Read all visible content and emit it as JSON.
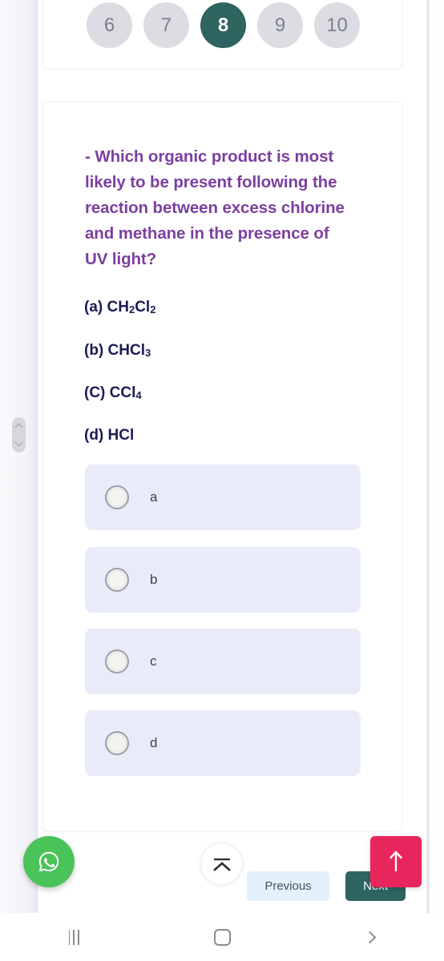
{
  "pager": {
    "pages": [
      {
        "label": "6",
        "active": false
      },
      {
        "label": "7",
        "active": false
      },
      {
        "label": "8",
        "active": true
      },
      {
        "label": "9",
        "active": false
      },
      {
        "label": "10",
        "active": false
      }
    ]
  },
  "question": {
    "text": "- Which organic product is most likely to be present following  the reaction between excess chlorine and methane in the presence of UV light?",
    "color": "#7c3f9f",
    "choices": [
      {
        "prefix": "(a)",
        "formula_html": "CH<sub>2</sub>Cl<sub>2</sub>",
        "plain": "(a) CH2Cl2"
      },
      {
        "prefix": "(b)",
        "formula_html": "CHCl<sub>3</sub>",
        "plain": "(b) CHCl3"
      },
      {
        "prefix": "(C)",
        "formula_html": "CCl<sub>4</sub>",
        "plain": "(C) CCl4"
      },
      {
        "prefix": "(d)",
        "formula_html": "HCl",
        "plain": "(d) HCl"
      }
    ]
  },
  "options": [
    {
      "label": "a",
      "selected": false
    },
    {
      "label": "b",
      "selected": false
    },
    {
      "label": "c",
      "selected": false
    },
    {
      "label": "d",
      "selected": false
    }
  ],
  "actions": {
    "previous_label": "Previous",
    "next_label": "Next",
    "whatsapp_icon": "whatsapp-icon",
    "scrolltop_icon": "collapse-up-icon",
    "backtotop_icon": "arrow-up-icon",
    "accent_teal": "#2d6460",
    "accent_pink": "#e9265c",
    "accent_green": "#4ac359",
    "previous_bg": "#e2f1fb"
  },
  "navbar": {
    "recents_icon": "recent-apps-icon",
    "home_icon": "home-icon",
    "back_icon": "back-icon"
  }
}
